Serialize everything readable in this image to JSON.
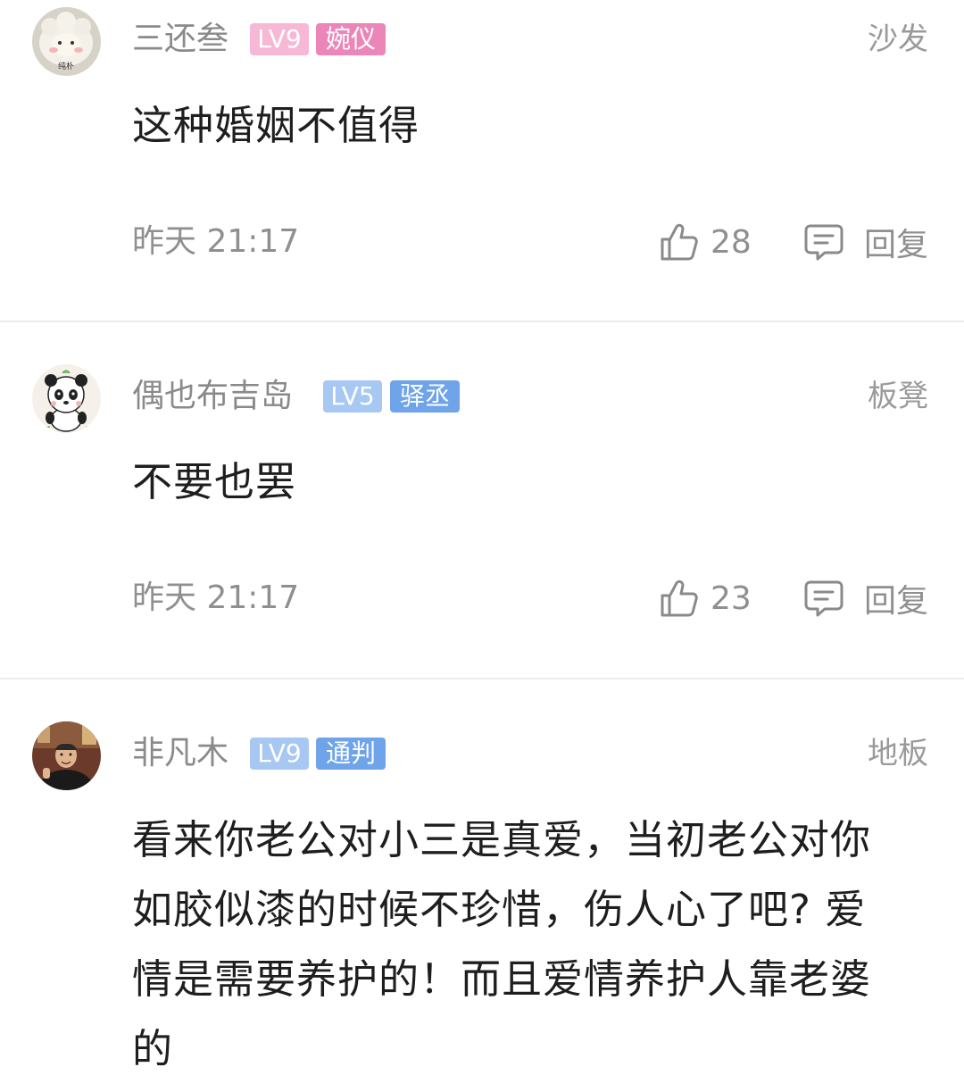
{
  "comments": [
    {
      "username": "三还叁",
      "level": "LV9",
      "title_badge": "婉仪",
      "level_color": "#f7b8d6",
      "title_color": "#ec86b8",
      "floor": "沙发",
      "avatar_icon": "sheep-avatar-icon",
      "avatar_caption": "纯朴",
      "content": "这种婚姻不值得",
      "time": "昨天 21:17",
      "likes": "28",
      "reply_label": "回复"
    },
    {
      "username": "偶也布吉岛",
      "level": "LV5",
      "title_badge": "驿丞",
      "level_color": "#a6c8f2",
      "title_color": "#6fa4ea",
      "floor": "板凳",
      "avatar_icon": "panda-avatar-icon",
      "content": "不要也罢",
      "time": "昨天 21:17",
      "likes": "23",
      "reply_label": "回复"
    },
    {
      "username": "非凡木",
      "level": "LV9",
      "title_badge": "通判",
      "level_color": "#a6c8f2",
      "title_color": "#6fa4ea",
      "floor": "地板",
      "avatar_icon": "person-photo-avatar-icon",
      "content": "看来你老公对小三是真爱，当初老公对你如胶似漆的时候不珍惜，伤人心了吧? 爱情是需要养护的！而且爱情养护人靠老婆的"
    }
  ],
  "icons": {
    "like": "thumbs-up-icon",
    "reply": "comment-bubble-icon"
  },
  "colors": {
    "text_primary": "#1e1e1e",
    "text_secondary": "#8f8f8f",
    "divider": "#ececec"
  }
}
